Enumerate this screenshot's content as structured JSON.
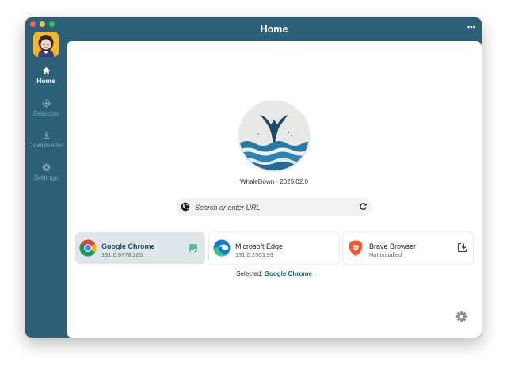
{
  "window": {
    "title": "Home"
  },
  "sidebar": {
    "items": [
      {
        "label": "Home",
        "icon": "home-icon",
        "active": true
      },
      {
        "label": "Detector",
        "icon": "detector-icon",
        "active": false
      },
      {
        "label": "Downloader",
        "icon": "download-icon",
        "active": false
      },
      {
        "label": "Settings",
        "icon": "gear-icon",
        "active": false
      }
    ]
  },
  "hero": {
    "app_name": "WhaleDown",
    "separator": "·",
    "version": "2025.02.0"
  },
  "search": {
    "placeholder": "Search or enter URL",
    "value": ""
  },
  "browsers": [
    {
      "name": "Google Chrome",
      "version": "131.0.6778.265",
      "selected": true,
      "icon": "chrome-icon"
    },
    {
      "name": "Microsoft Edge",
      "version": "131.0.2903.99",
      "selected": false,
      "icon": "edge-icon"
    },
    {
      "name": "Brave Browser",
      "version": "Not installed",
      "selected": false,
      "icon": "brave-icon",
      "action_icon": "install-icon"
    }
  ],
  "selection": {
    "label": "Selected:",
    "value": "Google Chrome"
  },
  "colors": {
    "sidebar_bg": "#2c5f78",
    "accent": "#1c5a7a",
    "check": "#5bb99a"
  }
}
